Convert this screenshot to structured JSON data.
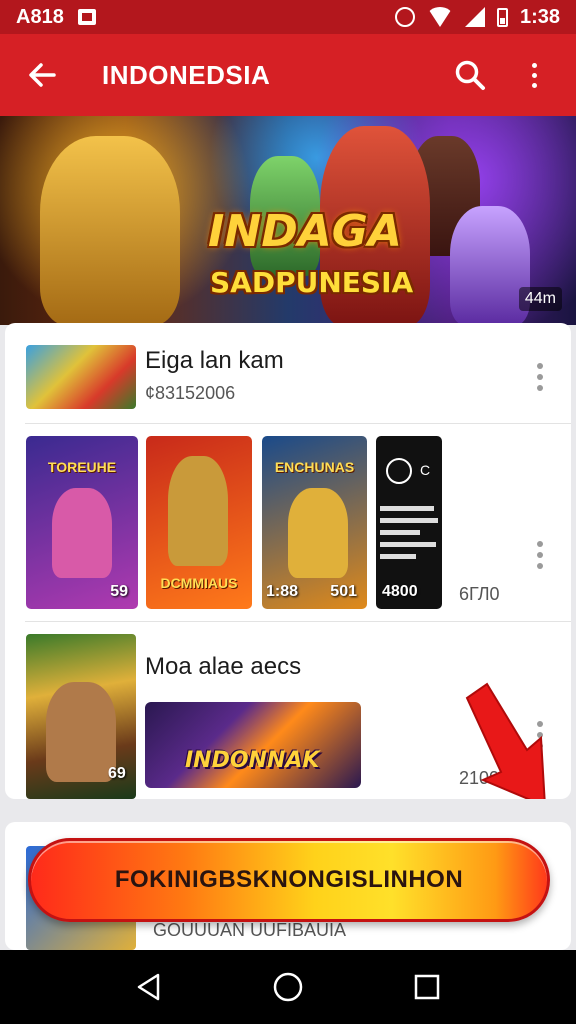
{
  "status_bar": {
    "left_text": "A818",
    "time": "1:38"
  },
  "app_bar": {
    "title": "INDONEDSIA"
  },
  "banner": {
    "title": "INDAGA",
    "subtitle": "SADPUNESIA",
    "badge": "44m"
  },
  "list": {
    "item1": {
      "title": "Eiga lan kam",
      "subtitle": "¢83152006"
    },
    "tiles": [
      {
        "heading": "TOREUHE",
        "label": "59",
        "colors": [
          "#3a2a90",
          "#b03ab0"
        ],
        "figure": "#d85aa8"
      },
      {
        "heading": "DCMMIAUS",
        "label": "",
        "colors": [
          "#c82a1a",
          "#ff7a1a"
        ],
        "figure": "#c99a3a"
      },
      {
        "heading": "ENCHUNAS",
        "label": "1:88",
        "colors": [
          "#1a4a8a",
          "#e08a1a"
        ],
        "figure": "#e0b03a"
      }
    ],
    "tile3_extra": "501",
    "dark_tile": {
      "mark": "C",
      "label": "4800"
    },
    "row2_count": "6ГЛ0",
    "item2": {
      "title": "Moa alae aecs",
      "thumb_label": "69",
      "wide_thumb_title": "INDONNAK",
      "count": "2100"
    },
    "item3": {
      "subtitle": "GOUUUAN UUFIBAUIA"
    }
  },
  "cta": {
    "label": "FOKINIGBSKNONGISLINHON"
  },
  "icons": {
    "back": "arrow-left-icon",
    "search": "search-icon",
    "more": "more-vertical-icon",
    "annotation": "red-arrow-icon",
    "nav_back": "triangle-back-icon",
    "nav_home": "circle-home-icon",
    "nav_recents": "square-recents-icon"
  },
  "colors": {
    "app_bar": "#d62025",
    "status_bar": "#b3171d",
    "cta_start": "#ff2a1a",
    "cta_mid": "#ffd21a"
  }
}
